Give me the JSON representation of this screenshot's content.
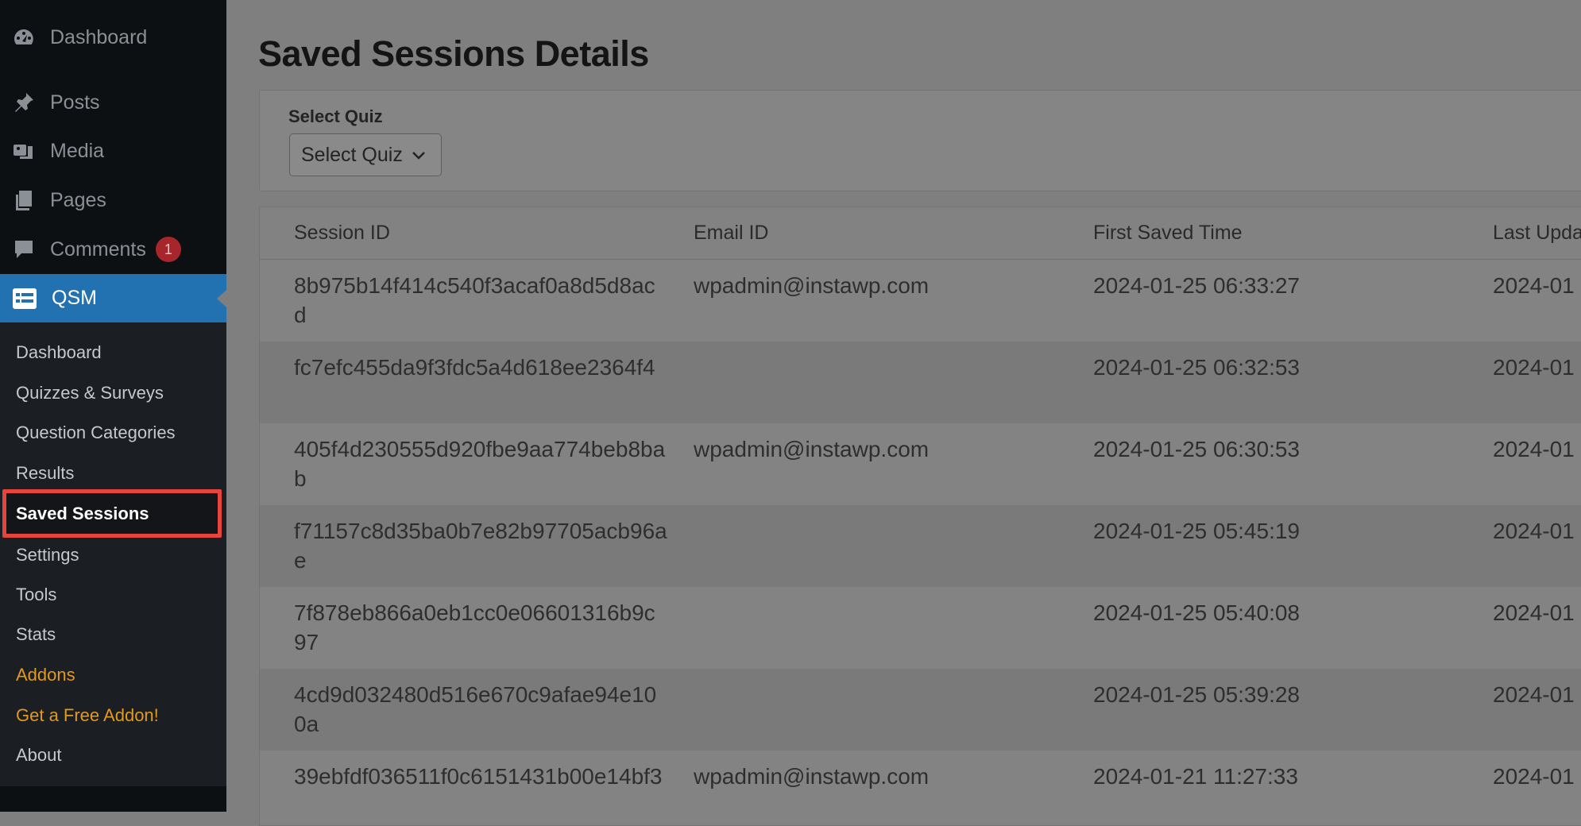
{
  "sidebar": {
    "menu": [
      {
        "label": "Dashboard",
        "icon": "dashboard-icon"
      },
      {
        "label": "Posts",
        "icon": "pushpin-icon"
      },
      {
        "label": "Media",
        "icon": "media-icon"
      },
      {
        "label": "Pages",
        "icon": "pages-icon"
      },
      {
        "label": "Comments",
        "icon": "comment-icon",
        "badge": "1"
      }
    ],
    "qsm": {
      "label": "QSM",
      "icon": "qsm-icon"
    },
    "submenu": [
      {
        "label": "Dashboard"
      },
      {
        "label": "Quizzes & Surveys"
      },
      {
        "label": "Question Categories"
      },
      {
        "label": "Results"
      },
      {
        "label": "Saved Sessions"
      },
      {
        "label": "Settings"
      },
      {
        "label": "Tools"
      },
      {
        "label": "Stats"
      },
      {
        "label": "Addons"
      },
      {
        "label": "Get a Free Addon!"
      },
      {
        "label": "About"
      }
    ]
  },
  "page": {
    "title": "Saved Sessions Details",
    "filter": {
      "label": "Select Quiz",
      "selected": "Select Quiz"
    }
  },
  "table": {
    "columns": [
      "Session ID",
      "Email ID",
      "First Saved Time",
      "Last Upda"
    ],
    "rows": [
      {
        "session_id": "8b975b14f414c540f3acaf0a8d5d8acd",
        "email": "wpadmin@instawp.com",
        "first_saved": "2024-01-25 06:33:27",
        "last_updated": "2024-01"
      },
      {
        "session_id": "fc7efc455da9f3fdc5a4d618ee2364f4",
        "email": "",
        "first_saved": "2024-01-25 06:32:53",
        "last_updated": "2024-01"
      },
      {
        "session_id": "405f4d230555d920fbe9aa774beb8bab",
        "email": "wpadmin@instawp.com",
        "first_saved": "2024-01-25 06:30:53",
        "last_updated": "2024-01"
      },
      {
        "session_id": "f71157c8d35ba0b7e82b97705acb96ae",
        "email": "",
        "first_saved": "2024-01-25 05:45:19",
        "last_updated": "2024-01"
      },
      {
        "session_id": "7f878eb866a0eb1cc0e06601316b9c97",
        "email": "",
        "first_saved": "2024-01-25 05:40:08",
        "last_updated": "2024-01"
      },
      {
        "session_id": "4cd9d032480d516e670c9afae94e100a",
        "email": "",
        "first_saved": "2024-01-25 05:39:28",
        "last_updated": "2024-01"
      },
      {
        "session_id": "39ebfdf036511f0c6151431b00e14bf3",
        "email": "wpadmin@instawp.com",
        "first_saved": "2024-01-21 11:27:33",
        "last_updated": "2024-01"
      }
    ]
  }
}
